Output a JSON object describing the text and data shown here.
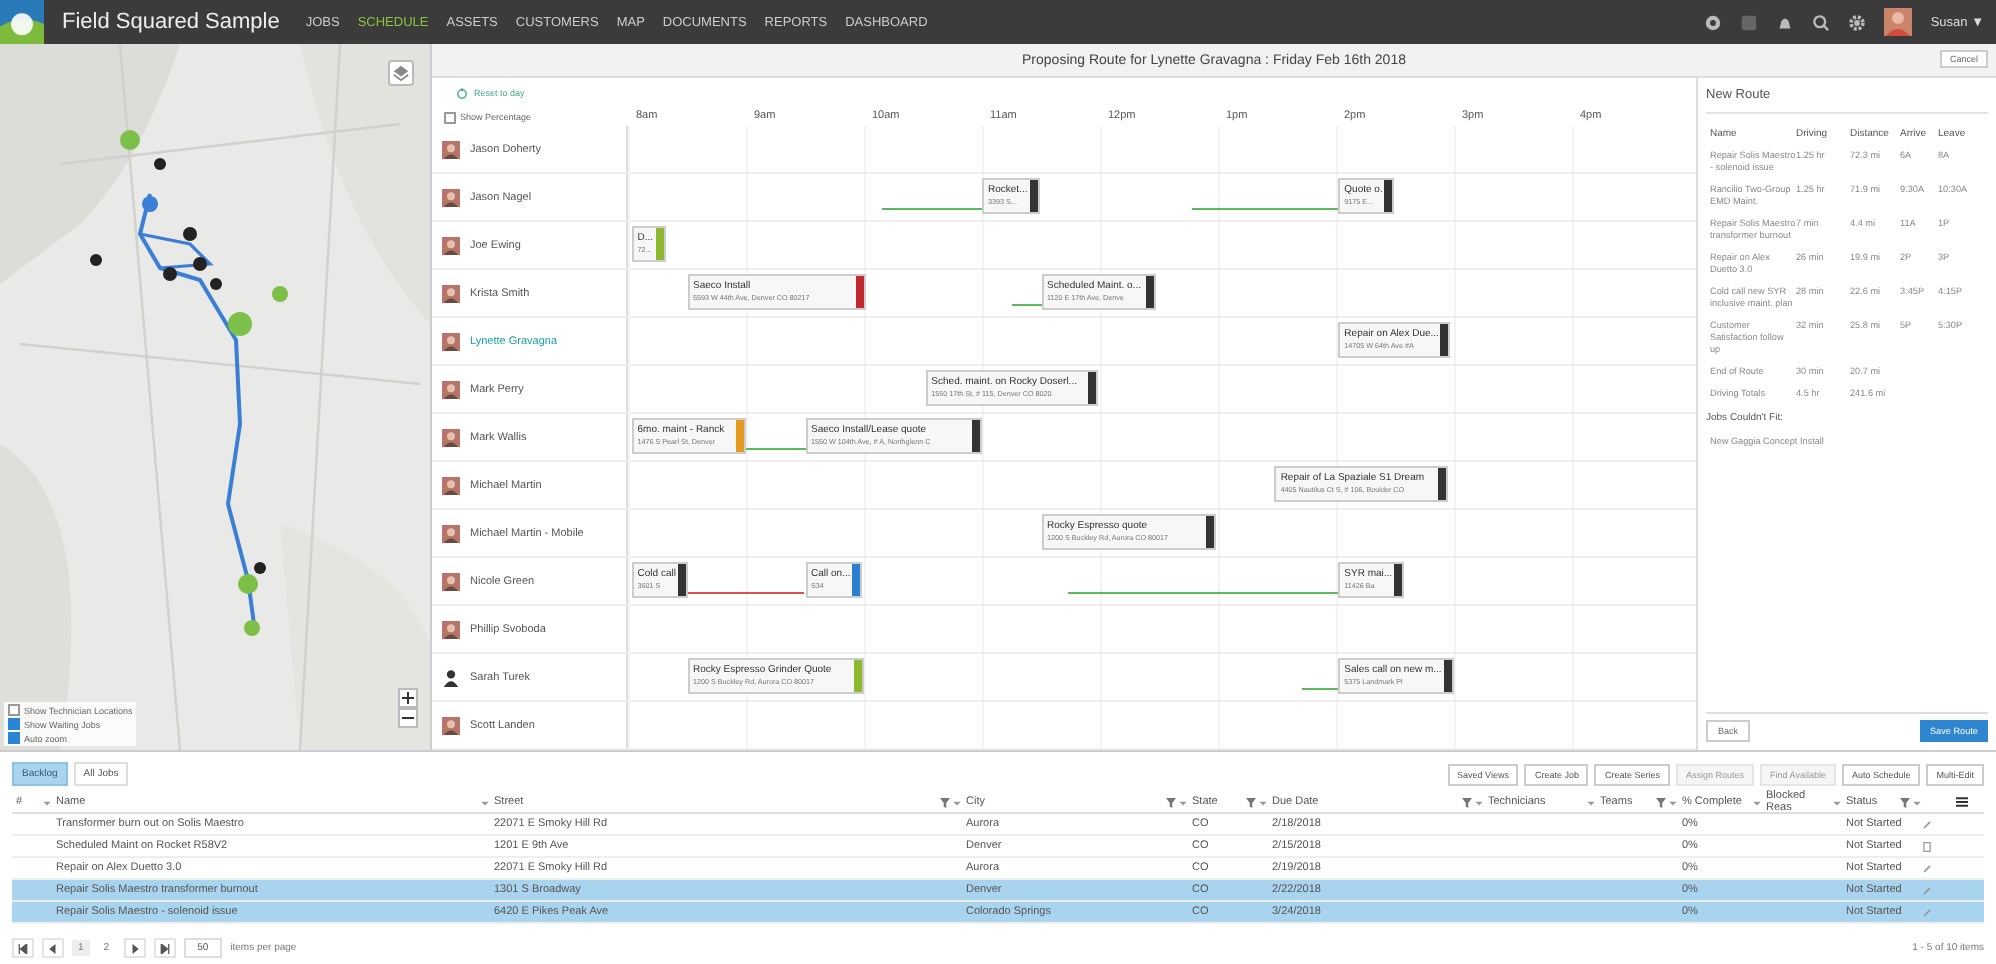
{
  "app": {
    "title": "Field Squared Sample",
    "nav": [
      {
        "label": "JOBS",
        "selected": false
      },
      {
        "label": "SCHEDULE",
        "selected": true
      },
      {
        "label": "ASSETS",
        "selected": false
      },
      {
        "label": "CUSTOMERS",
        "selected": false
      },
      {
        "label": "MAP",
        "selected": false
      },
      {
        "label": "DOCUMENTS",
        "selected": false
      },
      {
        "label": "REPORTS",
        "selected": false
      },
      {
        "label": "DASHBOARD",
        "selected": false
      }
    ],
    "user": "Susan ▼"
  },
  "map": {
    "options": [
      {
        "label": "Show Technician Locations",
        "checked": false
      },
      {
        "label": "Show Waiting Jobs",
        "checked": true
      },
      {
        "label": "Auto zoom",
        "checked": true
      }
    ]
  },
  "schedule": {
    "title": "Proposing Route for Lynette Gravagna : Friday Feb 16th 2018",
    "cancel": "Cancel",
    "reset": "Reset to day",
    "show_percentage": {
      "label": "Show Percentage",
      "checked": false
    },
    "hours": [
      "8am",
      "9am",
      "10am",
      "11am",
      "12pm",
      "1pm",
      "2pm",
      "3pm",
      "4pm"
    ],
    "technicians": [
      {
        "name": "Jason Doherty",
        "selected": false
      },
      {
        "name": "Jason Nagel",
        "selected": false,
        "jobs": [
          {
            "title": "Rocket...",
            "address": "3393 S...",
            "color": "#333333"
          },
          {
            "title": "Quote o.",
            "address": "9175 E...",
            "color": "#333333"
          }
        ],
        "travel": [
          {
            "kind": "drive"
          },
          {
            "kind": "drive"
          }
        ]
      },
      {
        "name": "Joe Ewing",
        "selected": false,
        "jobs": [
          {
            "title": "D...",
            "address": "72...",
            "color": "#8db72e"
          }
        ]
      },
      {
        "name": "Krista Smith",
        "selected": false,
        "jobs": [
          {
            "title": "Saeco Install",
            "address": "5593 W 44th Ave, Denver CO 80217",
            "color": "#c0282d"
          },
          {
            "title": "Scheduled Maint. o...",
            "address": "1120 E 17th Ave, Denve",
            "color": "#333333"
          }
        ],
        "travel": [
          {
            "kind": "drive"
          }
        ]
      },
      {
        "name": "Lynette Gravagna",
        "selected": true,
        "jobs": [
          {
            "title": "Repair on Alex Due...",
            "address": "14705 W 64th Ave #A",
            "color": "#333333"
          }
        ]
      },
      {
        "name": "Mark Perry",
        "selected": false,
        "jobs": [
          {
            "title": "Sched. maint. on Rocky Doserl...",
            "address": "1550 17th St, # 115, Denver CO 8020",
            "color": "#333333"
          }
        ]
      },
      {
        "name": "Mark Wallis",
        "selected": false,
        "jobs": [
          {
            "title": "6mo. maint - Ranck",
            "address": "1476 S Pearl St, Denver",
            "color": "#e39a1e"
          },
          {
            "title": "Saeco Install/Lease quote",
            "address": "1550 W 104th Ave, # A, Northglenn C",
            "color": "#333333"
          }
        ],
        "travel": [
          {
            "kind": "drive"
          }
        ]
      },
      {
        "name": "Michael Martin",
        "selected": false,
        "jobs": [
          {
            "title": "Repair of La Spaziale S1 Dream",
            "address": "4405 Nautilus Ct S, # 106, Boulder CO",
            "color": "#333333"
          }
        ]
      },
      {
        "name": "Michael Martin - Mobile",
        "selected": false,
        "jobs": [
          {
            "title": "Rocky Espresso quote",
            "address": "1200 S Buckley Rd, Aurora CO 80017",
            "color": "#333333"
          }
        ]
      },
      {
        "name": "Nicole Green",
        "selected": false,
        "jobs": [
          {
            "title": "Cold call",
            "address": "3601 S",
            "color": "#333333"
          },
          {
            "title": "Call on...",
            "address": "S34",
            "color": "#2a7fd0"
          },
          {
            "title": "SYR mai...",
            "address": "11426 Ba",
            "color": "#333333"
          }
        ],
        "travel": [
          {
            "kind": "late"
          },
          {
            "kind": "drive"
          }
        ]
      },
      {
        "name": "Phillip Svoboda",
        "selected": false
      },
      {
        "name": "Sarah Turek",
        "kind": "placeholder",
        "selected": false,
        "jobs": [
          {
            "title": "Rocky Espresso Grinder Quote",
            "address": "1200 S Buckley Rd, Aurora CO 80017",
            "color": "#8db72e"
          },
          {
            "title": "Sales call on new m...",
            "address": "5375 Landmark Pl",
            "color": "#333333"
          }
        ],
        "travel": [
          {
            "kind": "drive"
          }
        ]
      },
      {
        "name": "Scott Landen",
        "selected": false
      }
    ]
  },
  "route": {
    "title": "New Route",
    "columns": [
      "Name",
      "Driving",
      "Distance",
      "Arrive",
      "Leave"
    ],
    "rows": [
      [
        "Repair Solis Maestro - solenoid issue",
        "1.25 hr",
        "72.3 mi",
        "6A",
        "8A"
      ],
      [
        "Rancilio Two-Group EMD Maint.",
        "1.25 hr",
        "71.9 mi",
        "9:30A",
        "10:30A"
      ],
      [
        "Repair Solis Maestro transformer burnout",
        "7 min",
        "4.4 mi",
        "11A",
        "1P"
      ],
      [
        "Repair on Alex Duetto 3.0",
        "26 min",
        "19.9 mi",
        "2P",
        "3P"
      ],
      [
        "Cold call new SYR inclusive maint. plan",
        "28 min",
        "22.6 mi",
        "3:45P",
        "4:15P"
      ],
      [
        "Customer Satisfaction follow up",
        "32 min",
        "25.8 mi",
        "5P",
        "5:30P"
      ],
      [
        "End of Route",
        "30 min",
        "20.7 mi"
      ],
      [
        "Driving Totals",
        "4.5 hr",
        "241.6 mi"
      ]
    ],
    "unfit_title": "Jobs Couldn't Fit:",
    "unfit": [
      "New Gaggia Concept Install"
    ],
    "back": "Back",
    "save": "Save Route"
  },
  "grid": {
    "tabs": [
      {
        "label": "Backlog",
        "selected": true
      },
      {
        "label": "All Jobs",
        "selected": false
      }
    ],
    "actions": [
      {
        "label": "Saved Views",
        "disabled": false
      },
      {
        "label": "Create Job",
        "disabled": false
      },
      {
        "label": "Create Series",
        "disabled": false
      },
      {
        "label": "Assign Routes",
        "disabled": true
      },
      {
        "label": "Find Available",
        "disabled": true
      },
      {
        "label": "Auto Schedule",
        "disabled": false
      },
      {
        "label": "Multi-Edit",
        "disabled": false
      }
    ],
    "columns": [
      {
        "label": "#",
        "filter": false
      },
      {
        "label": "Name",
        "filter": false
      },
      {
        "label": "Street",
        "filter": true
      },
      {
        "label": "City",
        "filter": true
      },
      {
        "label": "State",
        "filter": true
      },
      {
        "label": "Due Date",
        "filter": true
      },
      {
        "label": "Technicians",
        "filter": false
      },
      {
        "label": "Teams",
        "filter": true
      },
      {
        "label": "% Complete",
        "filter": false
      },
      {
        "label": "Blocked Reas",
        "filter": false
      },
      {
        "label": "Status",
        "filter": true
      }
    ],
    "rows": [
      {
        "name": "Transformer burn out on Solis Maestro",
        "street": "22071 E Smoky Hill Rd",
        "city": "Aurora",
        "state": "CO",
        "due_date": "2/18/2018",
        "complete": "0%",
        "status": "Not Started",
        "kind": "edit",
        "selected": false
      },
      {
        "name": "Scheduled Maint on Rocket R58V2",
        "street": "1201 E 9th Ave",
        "city": "Denver",
        "state": "CO",
        "due_date": "2/15/2018",
        "complete": "0%",
        "status": "Not Started",
        "kind": "note",
        "selected": false
      },
      {
        "name": "Repair on Alex Duetto 3.0",
        "street": "22071 E Smoky Hill Rd",
        "city": "Aurora",
        "state": "CO",
        "due_date": "2/19/2018",
        "complete": "0%",
        "status": "Not Started",
        "kind": "edit",
        "selected": false
      },
      {
        "name": "Repair Solis Maestro transformer burnout",
        "street": "1301 S Broadway",
        "city": "Denver",
        "state": "CO",
        "due_date": "2/22/2018",
        "complete": "0%",
        "status": "Not Started",
        "kind": "edit",
        "selected": true
      },
      {
        "name": "Repair Solis Maestro - solenoid issue",
        "street": "6420 E Pikes Peak Ave",
        "city": "Colorado Springs",
        "state": "CO",
        "due_date": "3/24/2018",
        "complete": "0%",
        "status": "Not Started",
        "kind": "edit",
        "selected": true
      }
    ],
    "pager": {
      "pages": [
        {
          "label": "1",
          "selected": true
        },
        {
          "label": "2",
          "selected": false
        }
      ],
      "size": "50",
      "size_label": "items per page",
      "summary": "1 - 5 of 10 items"
    }
  }
}
